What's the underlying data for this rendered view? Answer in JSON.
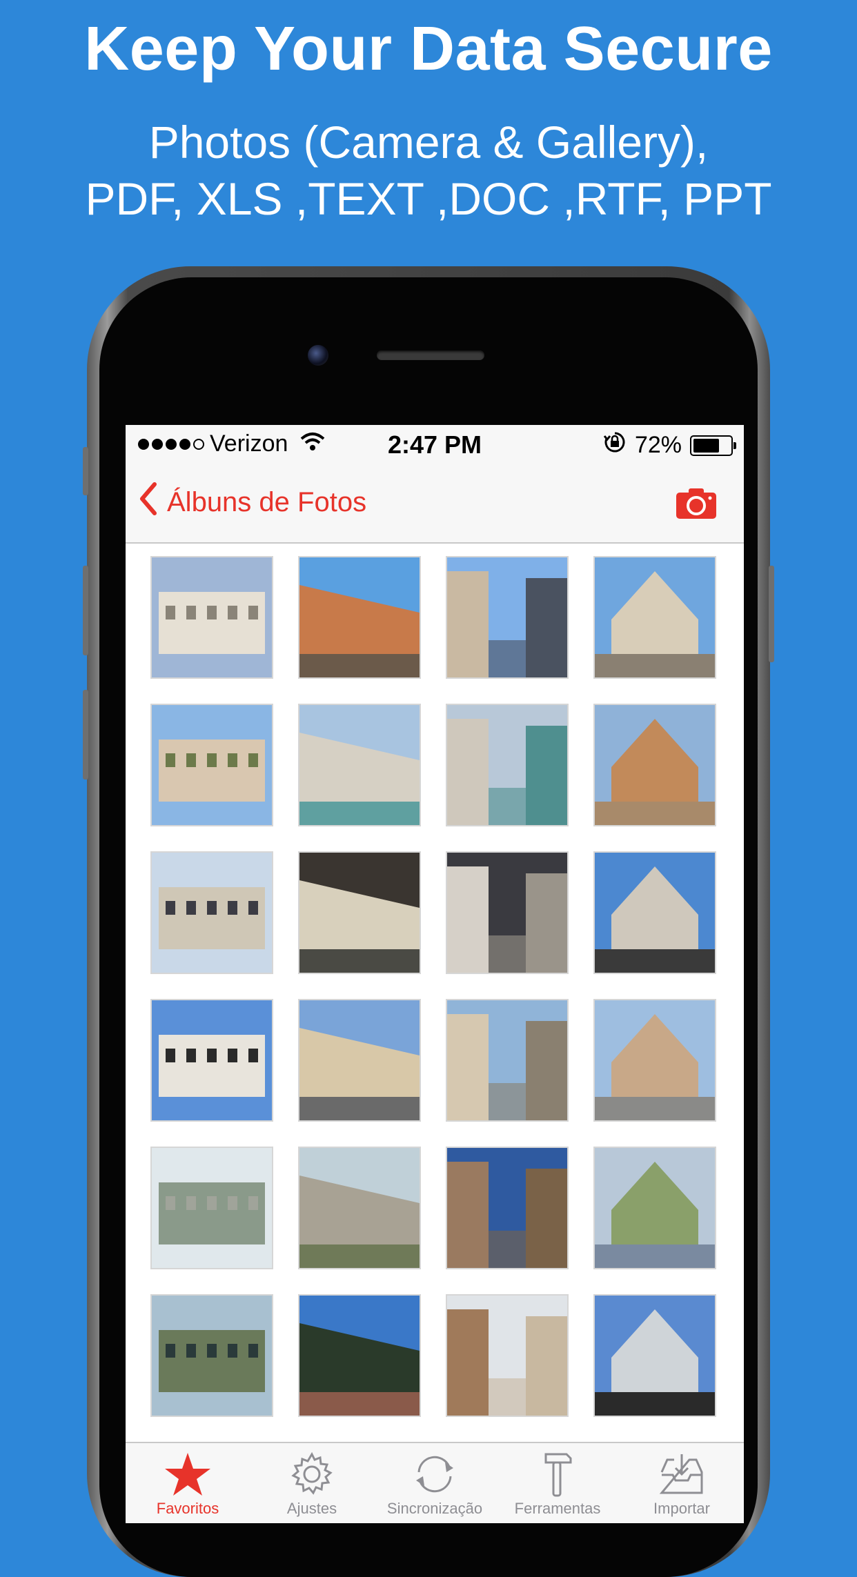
{
  "promo": {
    "headline": "Keep Your Data Secure",
    "subline1": "Photos (Camera & Gallery),",
    "subline2": "PDF, XLS ,TEXT ,DOC ,RTF, PPT"
  },
  "status_bar": {
    "carrier": "Verizon",
    "time": "2:47 PM",
    "battery_text": "72%",
    "battery_level": 0.72,
    "signal_bars": 4
  },
  "nav": {
    "back_label": "Álbuns de Fotos",
    "camera_icon": "camera-icon"
  },
  "photos": {
    "count": 24
  },
  "tabs": [
    {
      "label": "Favoritos",
      "icon": "star-icon",
      "active": true
    },
    {
      "label": "Ajustes",
      "icon": "gear-icon",
      "active": false
    },
    {
      "label": "Sincronização",
      "icon": "sync-icon",
      "active": false
    },
    {
      "label": "Ferramentas",
      "icon": "hammer-icon",
      "active": false
    },
    {
      "label": "Importar",
      "icon": "import-tray-icon",
      "active": false
    }
  ],
  "colors": {
    "background": "#2d87d9",
    "accent": "#e7332a",
    "tab_inactive": "#8e8e93"
  }
}
